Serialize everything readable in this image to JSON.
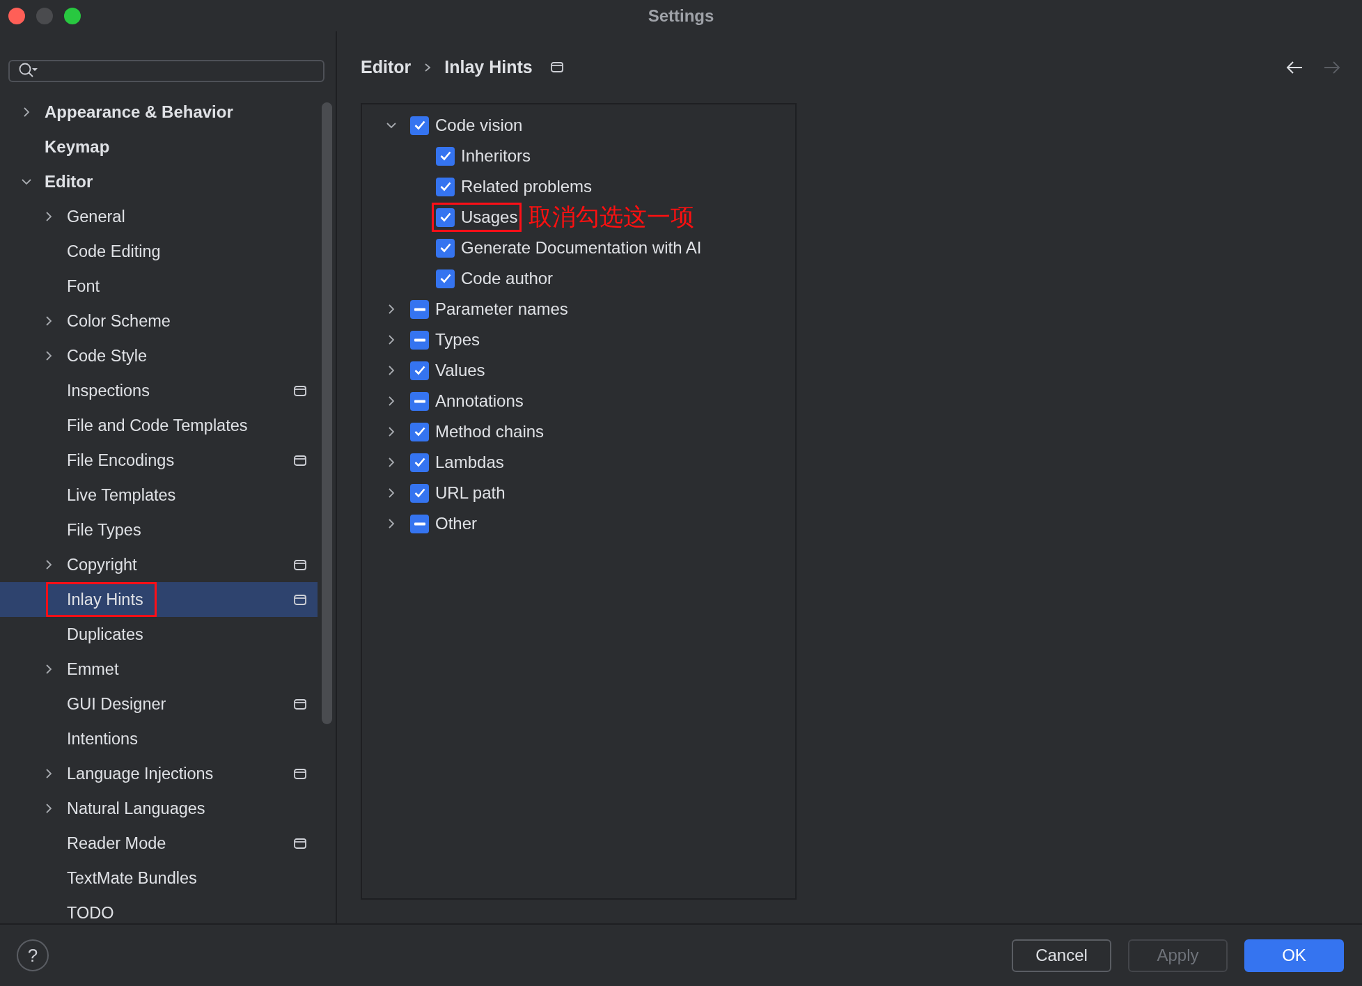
{
  "window": {
    "title": "Settings",
    "minimize_enabled": false
  },
  "sidebar": {
    "items": [
      {
        "label": "Appearance & Behavior",
        "expanded": false,
        "selected": false,
        "marked": false,
        "project_level": false
      },
      {
        "label": "Keymap",
        "selected": false,
        "marked": false,
        "project_level": false
      },
      {
        "label": "Editor",
        "expanded": true,
        "selected": false,
        "marked": false,
        "project_level": false,
        "children": [
          {
            "label": "General",
            "expanded": false,
            "selected": false,
            "marked": false,
            "project_level": false
          },
          {
            "label": "Code Editing",
            "selected": false,
            "marked": false,
            "project_level": false
          },
          {
            "label": "Font",
            "selected": false,
            "marked": false,
            "project_level": false
          },
          {
            "label": "Color Scheme",
            "expanded": false,
            "selected": false,
            "marked": false,
            "project_level": false
          },
          {
            "label": "Code Style",
            "expanded": false,
            "selected": false,
            "marked": false,
            "project_level": false
          },
          {
            "label": "Inspections",
            "selected": false,
            "marked": false,
            "project_level": true
          },
          {
            "label": "File and Code Templates",
            "selected": false,
            "marked": false,
            "project_level": false
          },
          {
            "label": "File Encodings",
            "selected": false,
            "marked": false,
            "project_level": true
          },
          {
            "label": "Live Templates",
            "selected": false,
            "marked": false,
            "project_level": false
          },
          {
            "label": "File Types",
            "selected": false,
            "marked": false,
            "project_level": false
          },
          {
            "label": "Copyright",
            "expanded": false,
            "selected": false,
            "marked": false,
            "project_level": true
          },
          {
            "label": "Inlay Hints",
            "selected": true,
            "marked": true,
            "project_level": true
          },
          {
            "label": "Duplicates",
            "selected": false,
            "marked": false,
            "project_level": false
          },
          {
            "label": "Emmet",
            "expanded": false,
            "selected": false,
            "marked": false,
            "project_level": false
          },
          {
            "label": "GUI Designer",
            "selected": false,
            "marked": false,
            "project_level": true
          },
          {
            "label": "Intentions",
            "selected": false,
            "marked": false,
            "project_level": false
          },
          {
            "label": "Language Injections",
            "expanded": false,
            "selected": false,
            "marked": false,
            "project_level": true
          },
          {
            "label": "Natural Languages",
            "expanded": false,
            "selected": false,
            "marked": false,
            "project_level": false
          },
          {
            "label": "Reader Mode",
            "selected": false,
            "marked": false,
            "project_level": true
          },
          {
            "label": "TextMate Bundles",
            "selected": false,
            "marked": false,
            "project_level": false
          },
          {
            "label": "TODO",
            "selected": false,
            "marked": false,
            "project_level": false
          }
        ]
      }
    ]
  },
  "breadcrumb": {
    "items": [
      "Editor",
      "Inlay Hints"
    ],
    "project_level": true
  },
  "navigation": {
    "back_enabled": true,
    "forward_enabled": false
  },
  "hints": {
    "items": [
      {
        "label": "Code vision",
        "checked": true,
        "expanded": true,
        "marked": false,
        "children": [
          {
            "label": "Inheritors",
            "checked": true,
            "marked": false
          },
          {
            "label": "Related problems",
            "checked": true,
            "marked": false
          },
          {
            "label": "Usages",
            "checked": true,
            "marked": true,
            "note": "取消勾选这一项"
          },
          {
            "label": "Generate Documentation with AI",
            "checked": true,
            "marked": false
          },
          {
            "label": "Code author",
            "checked": true,
            "marked": false
          }
        ]
      },
      {
        "label": "Parameter names",
        "indeterminate": true,
        "expanded": false,
        "marked": false
      },
      {
        "label": "Types",
        "indeterminate": true,
        "expanded": false,
        "marked": false
      },
      {
        "label": "Values",
        "checked": true,
        "expanded": false,
        "marked": false
      },
      {
        "label": "Annotations",
        "indeterminate": true,
        "expanded": false,
        "marked": false
      },
      {
        "label": "Method chains",
        "checked": true,
        "expanded": false,
        "marked": false
      },
      {
        "label": "Lambdas",
        "checked": true,
        "expanded": false,
        "marked": false
      },
      {
        "label": "URL path",
        "checked": true,
        "expanded": false,
        "marked": false
      },
      {
        "label": "Other",
        "indeterminate": true,
        "expanded": false,
        "marked": false
      }
    ]
  },
  "help": {
    "label": "?"
  },
  "buttons": [
    {
      "label": "Cancel",
      "kind": "secondary",
      "disabled": false
    },
    {
      "label": "Apply",
      "kind": "secondary",
      "disabled": true
    },
    {
      "label": "OK",
      "kind": "primary",
      "disabled": false
    }
  ]
}
